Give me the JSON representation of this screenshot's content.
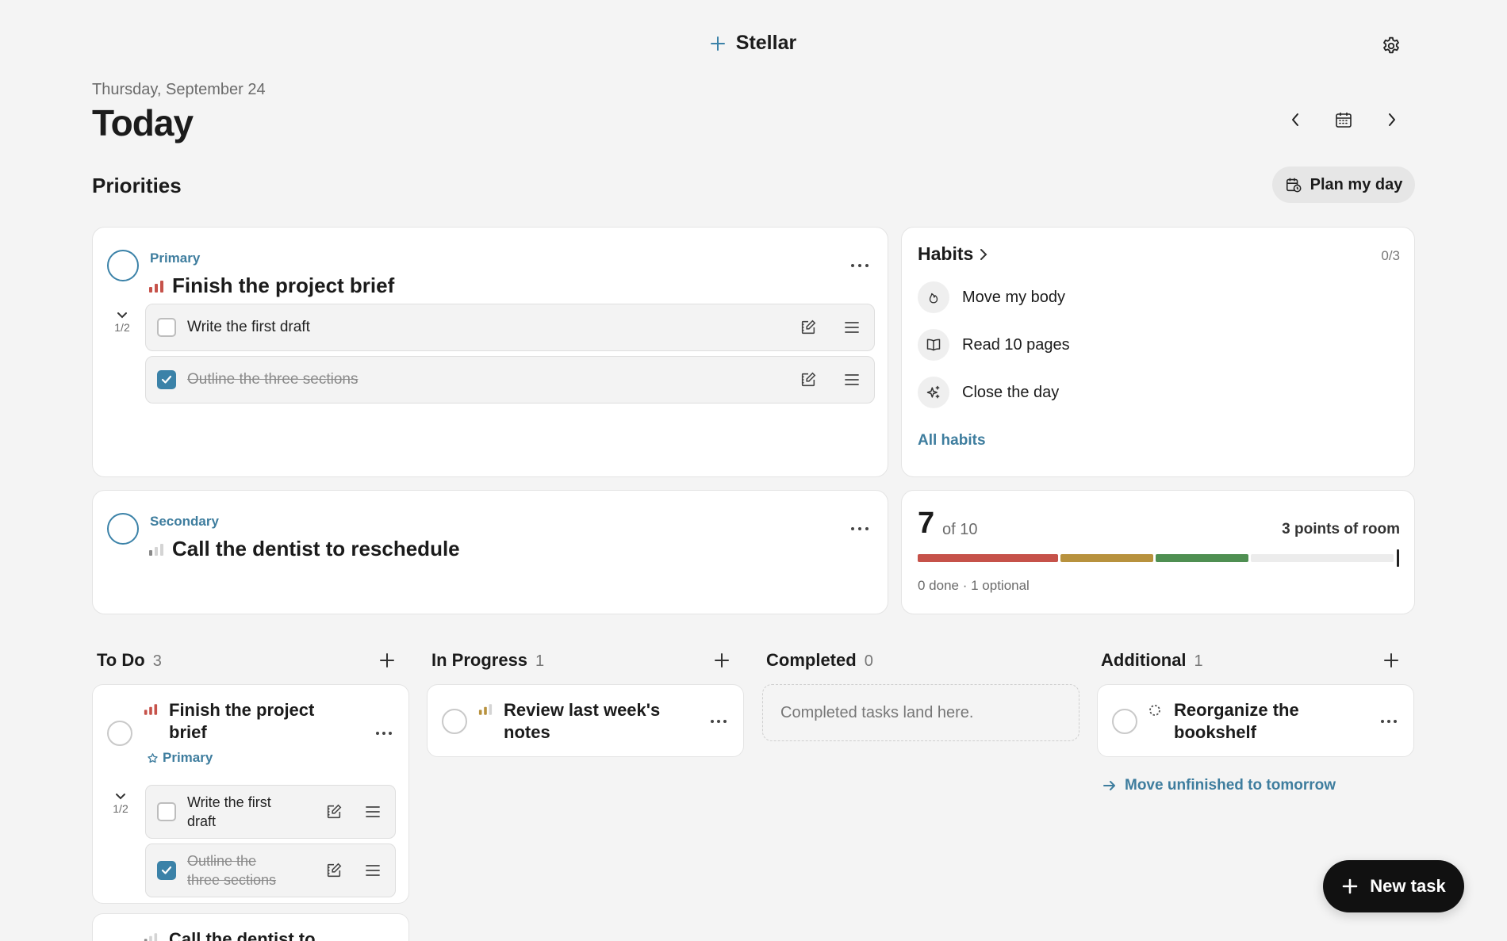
{
  "app": {
    "name": "Stellar"
  },
  "header": {
    "date": "Thursday, September 24",
    "title": "Today"
  },
  "priorities": {
    "title": "Priorities",
    "plan_button": "Plan my day",
    "primary": {
      "label": "Primary",
      "title": "Finish the project brief",
      "progress": "1/2",
      "subtasks": [
        {
          "text": "Write the first draft",
          "done": false
        },
        {
          "text": "Outline the three sections",
          "done": true
        }
      ]
    },
    "secondary": {
      "label": "Secondary",
      "title": "Call the dentist to reschedule"
    }
  },
  "habits": {
    "title": "Habits",
    "count": "0/3",
    "items": [
      {
        "label": "Move my body",
        "icon": "flame-icon"
      },
      {
        "label": "Read 10 pages",
        "icon": "book-icon"
      },
      {
        "label": "Close the day",
        "icon": "sparkle-icon"
      }
    ],
    "all_link": "All habits"
  },
  "points": {
    "value": "7",
    "of": "of 10",
    "room": "3 points of room",
    "note": "0 done · 1 optional",
    "segments": [
      {
        "value": 3,
        "color": "#c6524a"
      },
      {
        "value": 2,
        "color": "#b8923e"
      },
      {
        "value": 2,
        "color": "#4f8f52"
      }
    ],
    "max": 10
  },
  "columns": {
    "todo": {
      "title": "To Do",
      "count": "3",
      "cards": [
        {
          "title": "Finish the project brief",
          "tag": "Primary",
          "progress": "1/2",
          "subtasks": [
            {
              "text": "Write the first draft",
              "done": false
            },
            {
              "text": "Outline the three sections",
              "done": true
            }
          ]
        },
        {
          "title": "Call the dentist to"
        }
      ]
    },
    "in_progress": {
      "title": "In Progress",
      "count": "1",
      "cards": [
        {
          "title": "Review last week's notes"
        }
      ]
    },
    "completed": {
      "title": "Completed",
      "count": "0",
      "empty": "Completed tasks land here."
    },
    "additional": {
      "title": "Additional",
      "count": "1",
      "cards": [
        {
          "title": "Reorganize the bookshelf"
        }
      ],
      "move_link": "Move unfinished to tomorrow"
    }
  },
  "fab": {
    "label": "New task"
  },
  "colors": {
    "accent": "#3e7d9e",
    "priority_high": "#c6524a",
    "priority_med": "#b8923e",
    "priority_low": "#9e9e9e"
  }
}
